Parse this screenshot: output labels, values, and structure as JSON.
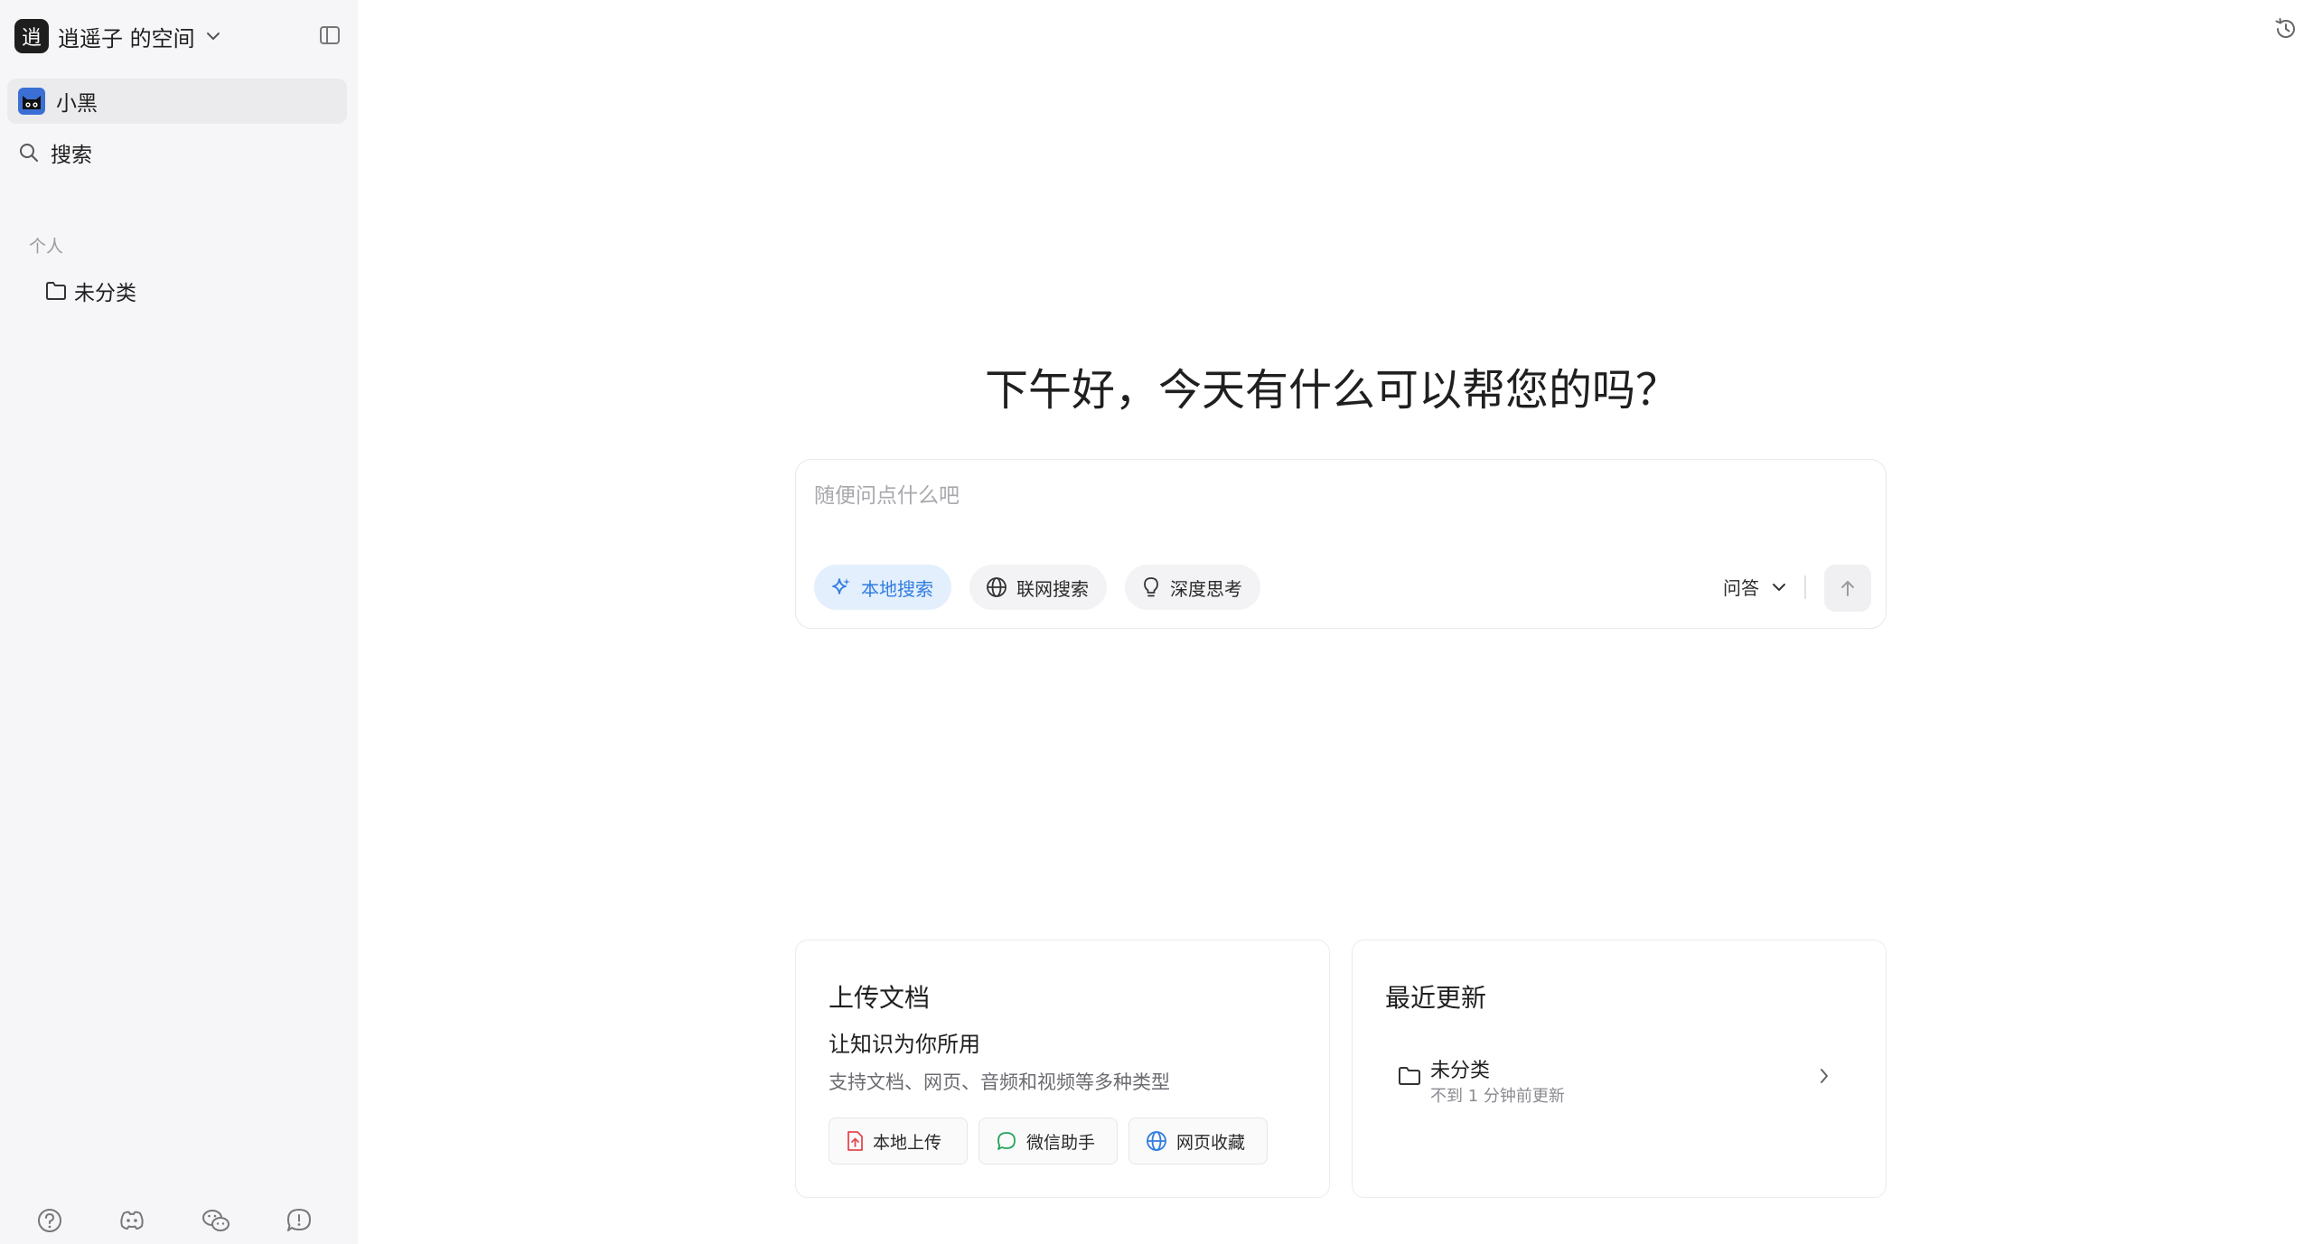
{
  "sidebar": {
    "workspace": {
      "logo_char": "逍",
      "name": "逍遥子 的空间"
    },
    "nav": {
      "xiaohei": "小黑",
      "search": "搜索"
    },
    "section_personal": "个人",
    "folders": [
      {
        "label": "未分类"
      }
    ],
    "bottom_icons": [
      "help-icon",
      "discord-icon",
      "wechat-icon",
      "feedback-icon"
    ]
  },
  "main": {
    "greeting": "下午好，今天有什么可以帮您的吗？",
    "chat": {
      "placeholder": "随便问点什么吧",
      "chips": {
        "local_search": "本地搜索",
        "web_search": "联网搜索",
        "deep_think": "深度思考"
      },
      "mode": "问答"
    },
    "upload_card": {
      "title": "上传文档",
      "subtitle": "让知识为你所用",
      "description": "支持文档、网页、音频和视频等多种类型",
      "buttons": {
        "local_upload": "本地上传",
        "wechat_assistant": "微信助手",
        "web_bookmark": "网页收藏"
      }
    },
    "recent_card": {
      "title": "最近更新",
      "items": [
        {
          "name": "未分类",
          "updated": "不到 1 分钟前更新"
        }
      ]
    }
  },
  "colors": {
    "sidebar_bg": "#f6f6f8",
    "accent_blue": "#2f7de1",
    "chip_active_bg": "#e3effd",
    "upload_red": "#e5484d",
    "wechat_green": "#22a55a",
    "web_blue": "#2f7de1"
  }
}
